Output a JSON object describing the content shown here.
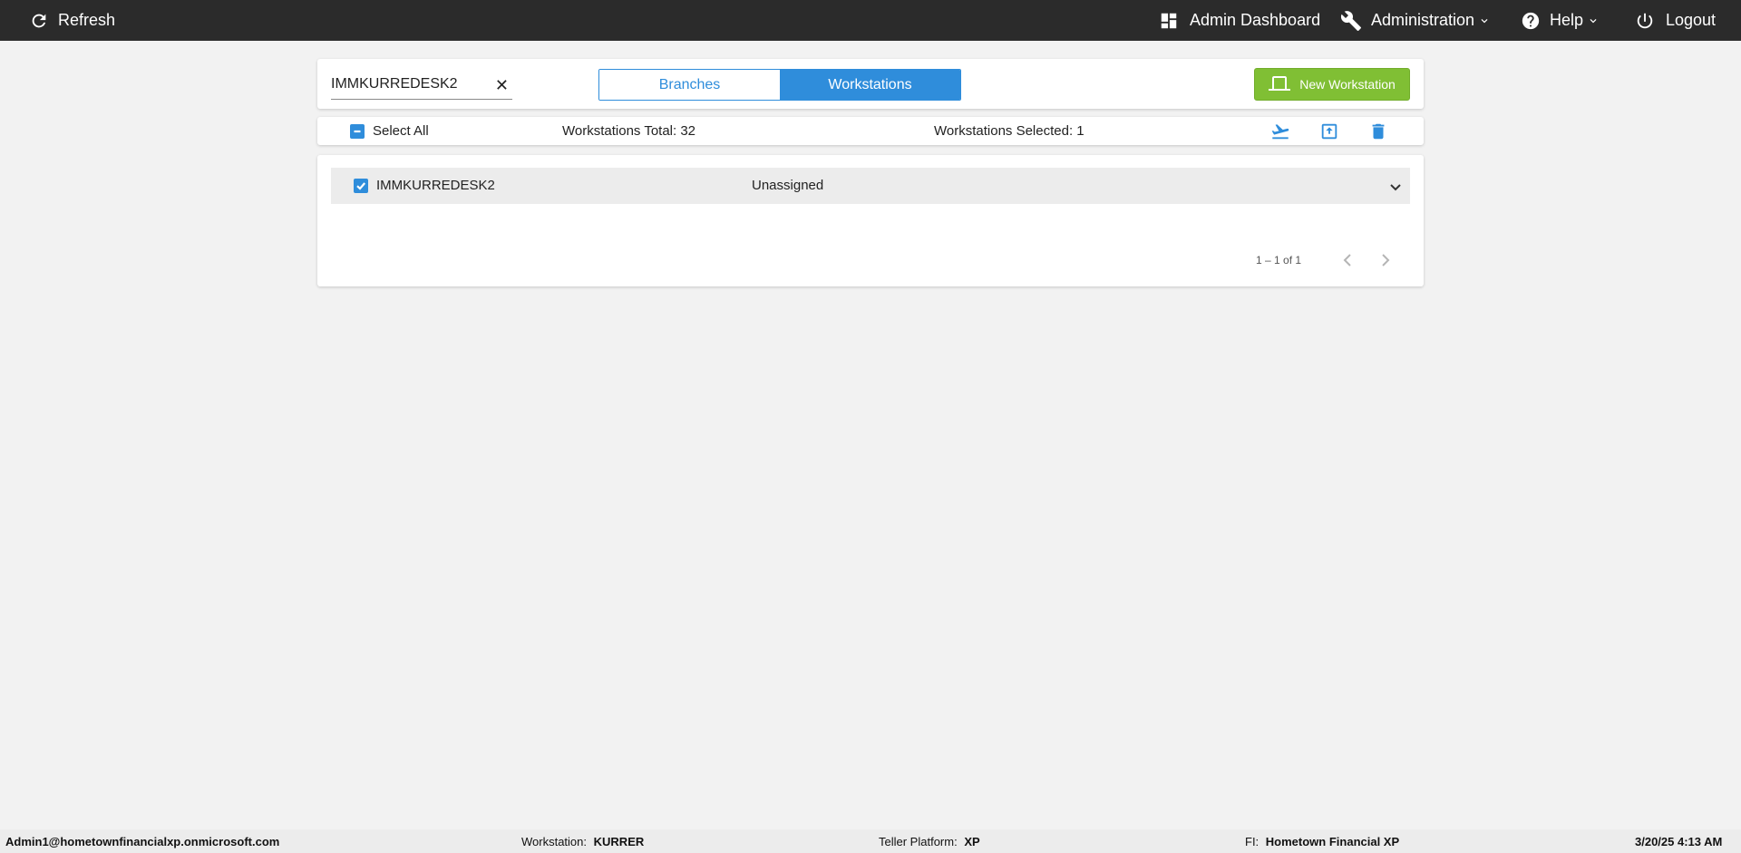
{
  "topbar": {
    "refresh_label": "Refresh",
    "admin_dashboard_label": "Admin Dashboard",
    "administration_label": "Administration",
    "help_label": "Help",
    "logout_label": "Logout",
    "background_color": "#2b2b2b"
  },
  "search": {
    "value": "IMMKURREDESK2",
    "clear_glyph": "✕"
  },
  "view_toggle": {
    "options": [
      {
        "label": "Branches",
        "active": false
      },
      {
        "label": "Workstations",
        "active": true
      }
    ],
    "accent_color": "#2f8ddb"
  },
  "new_workstation": {
    "label": "New Workstation",
    "color": "#80bf34"
  },
  "selection_bar": {
    "select_all_label": "Select All",
    "total_text": "Workstations Total: 32",
    "selected_text": "Workstations Selected: 1",
    "actions": [
      "plane-depart-icon",
      "upload-box-icon",
      "trash-icon"
    ]
  },
  "workstations": [
    {
      "name": "IMMKURREDESK2",
      "branch": "Unassigned",
      "selected": true
    }
  ],
  "pagination": {
    "range_text": "1 – 1 of 1"
  },
  "footer": {
    "user": "Admin1@hometownfinancialxp.onmicrosoft.com",
    "workstation_label": "Workstation:",
    "workstation_value": "KURRER",
    "teller_platform_label": "Teller Platform:",
    "teller_platform_value": "XP",
    "fi_label": "FI:",
    "fi_value": "Hometown Financial XP",
    "datetime": "3/20/25 4:13 AM"
  }
}
